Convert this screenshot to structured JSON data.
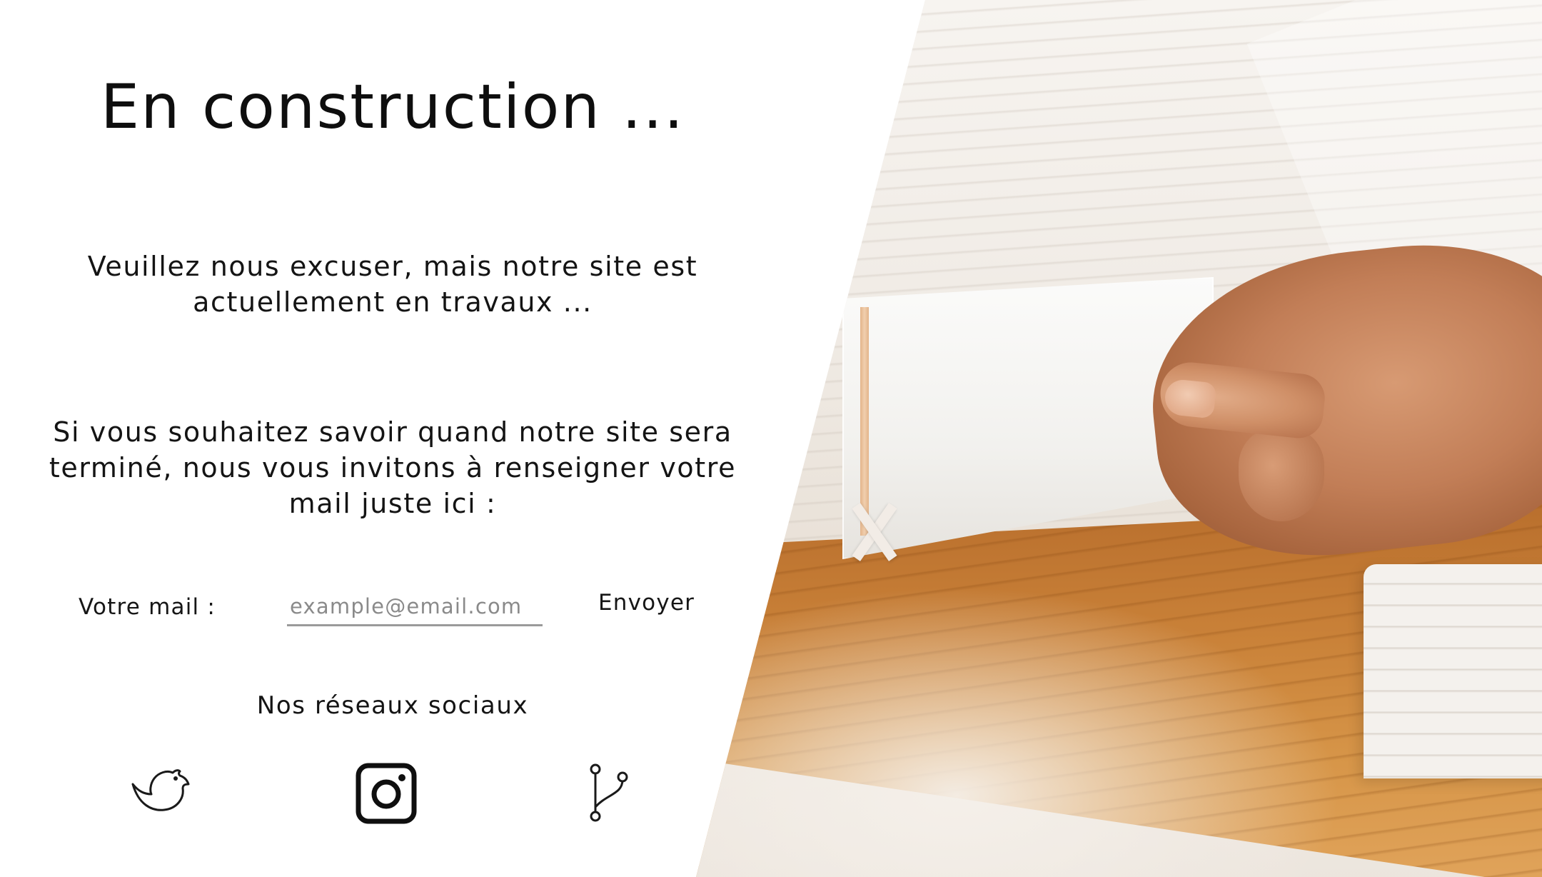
{
  "page": {
    "title": "En construction ...",
    "apology": "Veuillez nous excuser, mais notre site est actuellement en travaux ...",
    "notify_text": "Si vous souhaitez savoir quand notre site sera terminé, nous vous invitons à renseigner votre mail juste ici :"
  },
  "form": {
    "mail_label": "Votre mail :",
    "mail_placeholder": "example@email.com",
    "mail_value": "",
    "send_label": "Envoyer"
  },
  "social": {
    "title": "Nos réseaux sociaux",
    "icons": [
      "bird-icon",
      "instagram-icon",
      "git-branch-icon"
    ]
  },
  "colors": {
    "text": "#111111",
    "input_underline": "#9a9a9a",
    "placeholder": "#8a8a8a",
    "background": "#ffffff"
  }
}
